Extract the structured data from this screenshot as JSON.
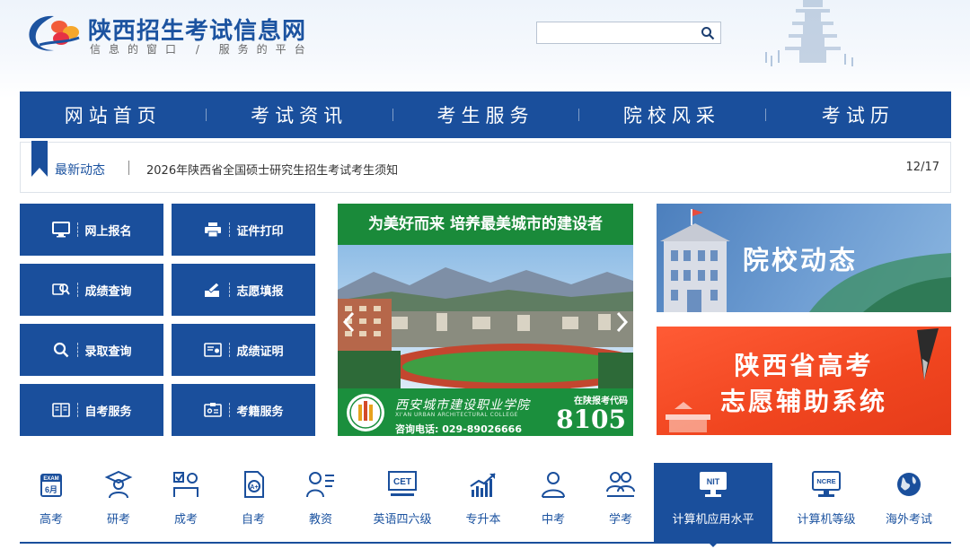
{
  "header": {
    "title": "陕西招生考试信息网",
    "slogan": "信息的窗口 / 服务的平台",
    "search_placeholder": ""
  },
  "nav": {
    "items": [
      "网站首页",
      "考试资讯",
      "考生服务",
      "院校风采",
      "考试历"
    ]
  },
  "news": {
    "tag": "最新动态",
    "headline": "2026年陕西省全国硕士研究生招生考试考生须知",
    "date": "12/17"
  },
  "quick_links": [
    {
      "label": "网上报名",
      "icon": "monitor-icon"
    },
    {
      "label": "证件打印",
      "icon": "printer-icon"
    },
    {
      "label": "成绩查询",
      "icon": "score-search-icon"
    },
    {
      "label": "志愿填报",
      "icon": "pen-icon"
    },
    {
      "label": "录取查询",
      "icon": "search-icon"
    },
    {
      "label": "成绩证明",
      "icon": "certificate-icon"
    },
    {
      "label": "自考服务",
      "icon": "book-icon"
    },
    {
      "label": "考籍服务",
      "icon": "id-card-icon"
    }
  ],
  "banner": {
    "headline": "为美好而来 培养最美城市的建设者",
    "school_cn": "西安城市建设职业学院",
    "school_en": "XI'AN URBAN ARCHITECTURAL COLLEGE",
    "phone": "咨询电话: 029-89026666",
    "code_label": "在陕报考代码",
    "code": "8105"
  },
  "promos": {
    "college_news": "院校动态",
    "gaokao_line1": "陕西省高考",
    "gaokao_line2": "志愿辅助系统"
  },
  "categories": [
    {
      "label": "高考",
      "icon": "exam-calendar-icon"
    },
    {
      "label": "研考",
      "icon": "graduate-icon"
    },
    {
      "label": "成考",
      "icon": "adult-exam-icon"
    },
    {
      "label": "自考",
      "icon": "self-study-icon"
    },
    {
      "label": "教资",
      "icon": "teacher-icon"
    },
    {
      "label": "英语四六级",
      "icon": "cet-icon"
    },
    {
      "label": "专升本",
      "icon": "upgrade-chart-icon"
    },
    {
      "label": "中考",
      "icon": "student-icon"
    },
    {
      "label": "学考",
      "icon": "classmates-icon"
    },
    {
      "label": "计算机应用水平",
      "icon": "nit-icon",
      "active": true
    },
    {
      "label": "计算机等级",
      "icon": "ncre-icon"
    },
    {
      "label": "海外考试",
      "icon": "globe-icon"
    }
  ],
  "colors": {
    "primary": "#1a4f9c",
    "green": "#1a8a3a",
    "orange": "#f0451f"
  }
}
